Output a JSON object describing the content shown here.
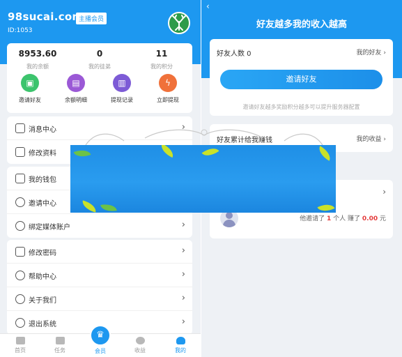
{
  "left": {
    "brand": "98sucai.com",
    "member_badge": "主播会员",
    "user_id": "ID:1053",
    "stats": [
      {
        "value": "8953.60",
        "label": "我的余额"
      },
      {
        "value": "0",
        "label": "我的徒弟"
      },
      {
        "value": "11",
        "label": "我的积分"
      }
    ],
    "quick_actions": [
      {
        "label": "邀请好友",
        "icon": "gift-icon",
        "color": "#3cc46d"
      },
      {
        "label": "余额明细",
        "icon": "document-icon",
        "color": "#9b59d6"
      },
      {
        "label": "提现记录",
        "icon": "printer-icon",
        "color": "#7d5bd6"
      },
      {
        "label": "立即提现",
        "icon": "lightning-icon",
        "color": "#f0713a"
      }
    ],
    "menu_group1": [
      {
        "label": "消息中心",
        "icon": "message-icon"
      },
      {
        "label": "修改资料",
        "icon": "profile-icon"
      }
    ],
    "menu_group2": [
      {
        "label": "我的钱包",
        "icon": "wallet-icon"
      },
      {
        "label": "邀请中心",
        "icon": "invite-icon"
      },
      {
        "label": "绑定媒体账户",
        "icon": "shield-check-icon"
      }
    ],
    "menu_group3": [
      {
        "label": "修改密码",
        "icon": "lock-icon"
      },
      {
        "label": "帮助中心",
        "icon": "help-icon"
      },
      {
        "label": "关于我们",
        "icon": "info-icon"
      },
      {
        "label": "退出系统",
        "icon": "power-icon"
      }
    ],
    "tabs": [
      {
        "label": "首页",
        "icon": "home-icon"
      },
      {
        "label": "任务",
        "icon": "task-icon"
      },
      {
        "label": "会员",
        "icon": "crown-icon"
      },
      {
        "label": "收益",
        "icon": "compass-icon"
      },
      {
        "label": "我的",
        "icon": "user-icon"
      }
    ],
    "active_tab": "我的",
    "accent_color": "#1d98f0"
  },
  "right": {
    "back_icon": "chevron-left-icon",
    "title": "好友越多我的收入越高",
    "friends_label": "好友人数 0",
    "my_friends_link": "我的好友",
    "invite_button": "邀请好友",
    "hint": "邀请好友越多奖励积分越多可以提升服务器配置",
    "earnings_label": "好友累计给我赚钱",
    "my_earnings_link": "我的收益",
    "invite_summary": {
      "prefix": "他邀请了",
      "count": "1",
      "middle": "个人 赚了",
      "amount": "0.00",
      "suffix": "元"
    }
  }
}
